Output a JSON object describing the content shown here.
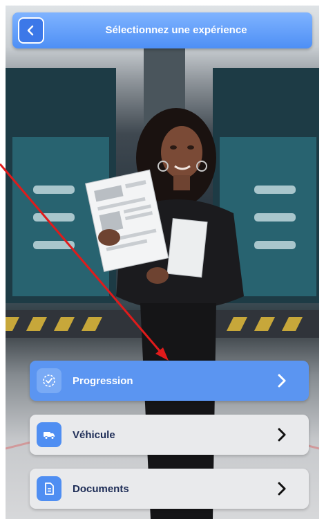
{
  "header": {
    "title": "Sélectionnez une expérience",
    "back_icon": "chevron-left-icon"
  },
  "menu": {
    "items": [
      {
        "label": "Progression",
        "icon": "progress-check-icon",
        "state": "active"
      },
      {
        "label": "Véhicule",
        "icon": "truck-icon",
        "state": "default"
      },
      {
        "label": "Documents",
        "icon": "document-icon",
        "state": "default"
      }
    ]
  },
  "colors": {
    "accent": "#4e8ff5",
    "active_item": "#5b95f1",
    "inactive_item": "#e9eaec",
    "dark_text": "#1d2c56",
    "annotation_arrow": "#e01b1b"
  }
}
